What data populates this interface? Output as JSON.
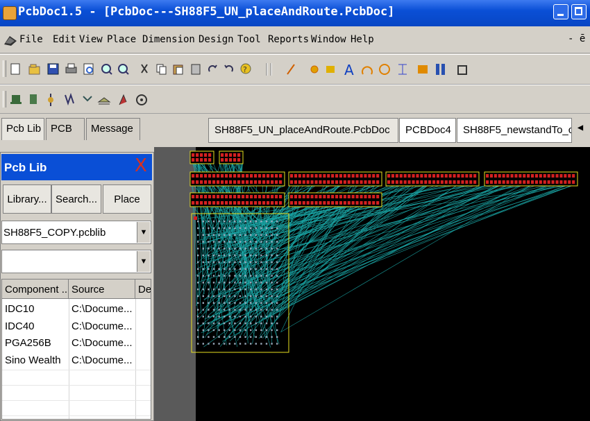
{
  "window": {
    "title": "PcbDoc1.5 - [PcbDoc---SH88F5_UN_placeAndRoute.PcbDoc]"
  },
  "menu": {
    "items": [
      "File",
      "Edit",
      "View",
      "Place",
      "Dimension",
      "Design",
      "Tool",
      "Reports",
      "Window",
      "Help"
    ],
    "close_glyph": "- ē"
  },
  "panel_tabs": [
    "Pcb Lib",
    "PCB",
    "Message"
  ],
  "document_tabs": [
    "SH88F5_UN_placeAndRoute.PcbDoc",
    "PCBDoc4",
    "SH88F5_newstandTo_c"
  ],
  "panel": {
    "title": "Pcb Lib",
    "close_glyph": "X",
    "buttons": [
      "Library...",
      "Search...",
      "Place"
    ],
    "library_select": "SH88F5_COPY.pcblib",
    "filter_select": "",
    "columns": [
      "Component ...",
      "Source",
      "De"
    ],
    "rows": [
      {
        "component": "IDC10",
        "source": "C:\\Docume..."
      },
      {
        "component": "IDC40",
        "source": "C:\\Docume..."
      },
      {
        "component": "PGA256B",
        "source": "C:\\Docume..."
      },
      {
        "component": "Sino Wealth",
        "source": "C:\\Docume..."
      }
    ]
  },
  "colors": {
    "titlebar": "#0a4fd6",
    "canvas": "#000000",
    "ratsnest": "#1aa5a5",
    "footprint_outline": "#e8e020",
    "pad": "#d42020"
  }
}
